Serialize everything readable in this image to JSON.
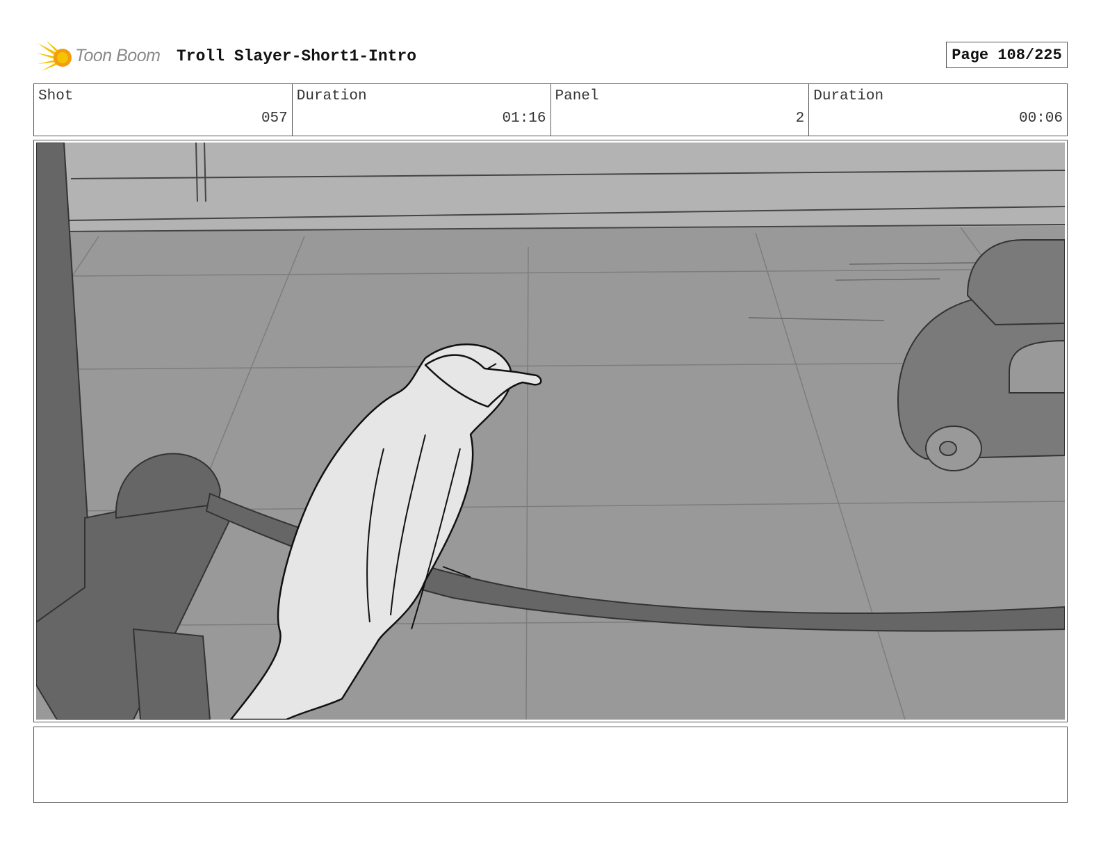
{
  "header": {
    "logo_text": "Toon Boom",
    "title": "Troll Slayer-Short1-Intro",
    "page_label": "Page 108/225"
  },
  "info": [
    {
      "label": "Shot",
      "value": "057"
    },
    {
      "label": "Duration",
      "value": "01:16"
    },
    {
      "label": "Panel",
      "value": "2"
    },
    {
      "label": "Duration",
      "value": "00:06"
    }
  ],
  "colors": {
    "logo_yellow": "#f5c400",
    "logo_orange": "#f39c12",
    "sketch_bg": "#999999",
    "sketch_dark": "#666666",
    "sketch_light": "#e6e6e6"
  },
  "icons": {
    "logo": "burst-logo-icon"
  }
}
